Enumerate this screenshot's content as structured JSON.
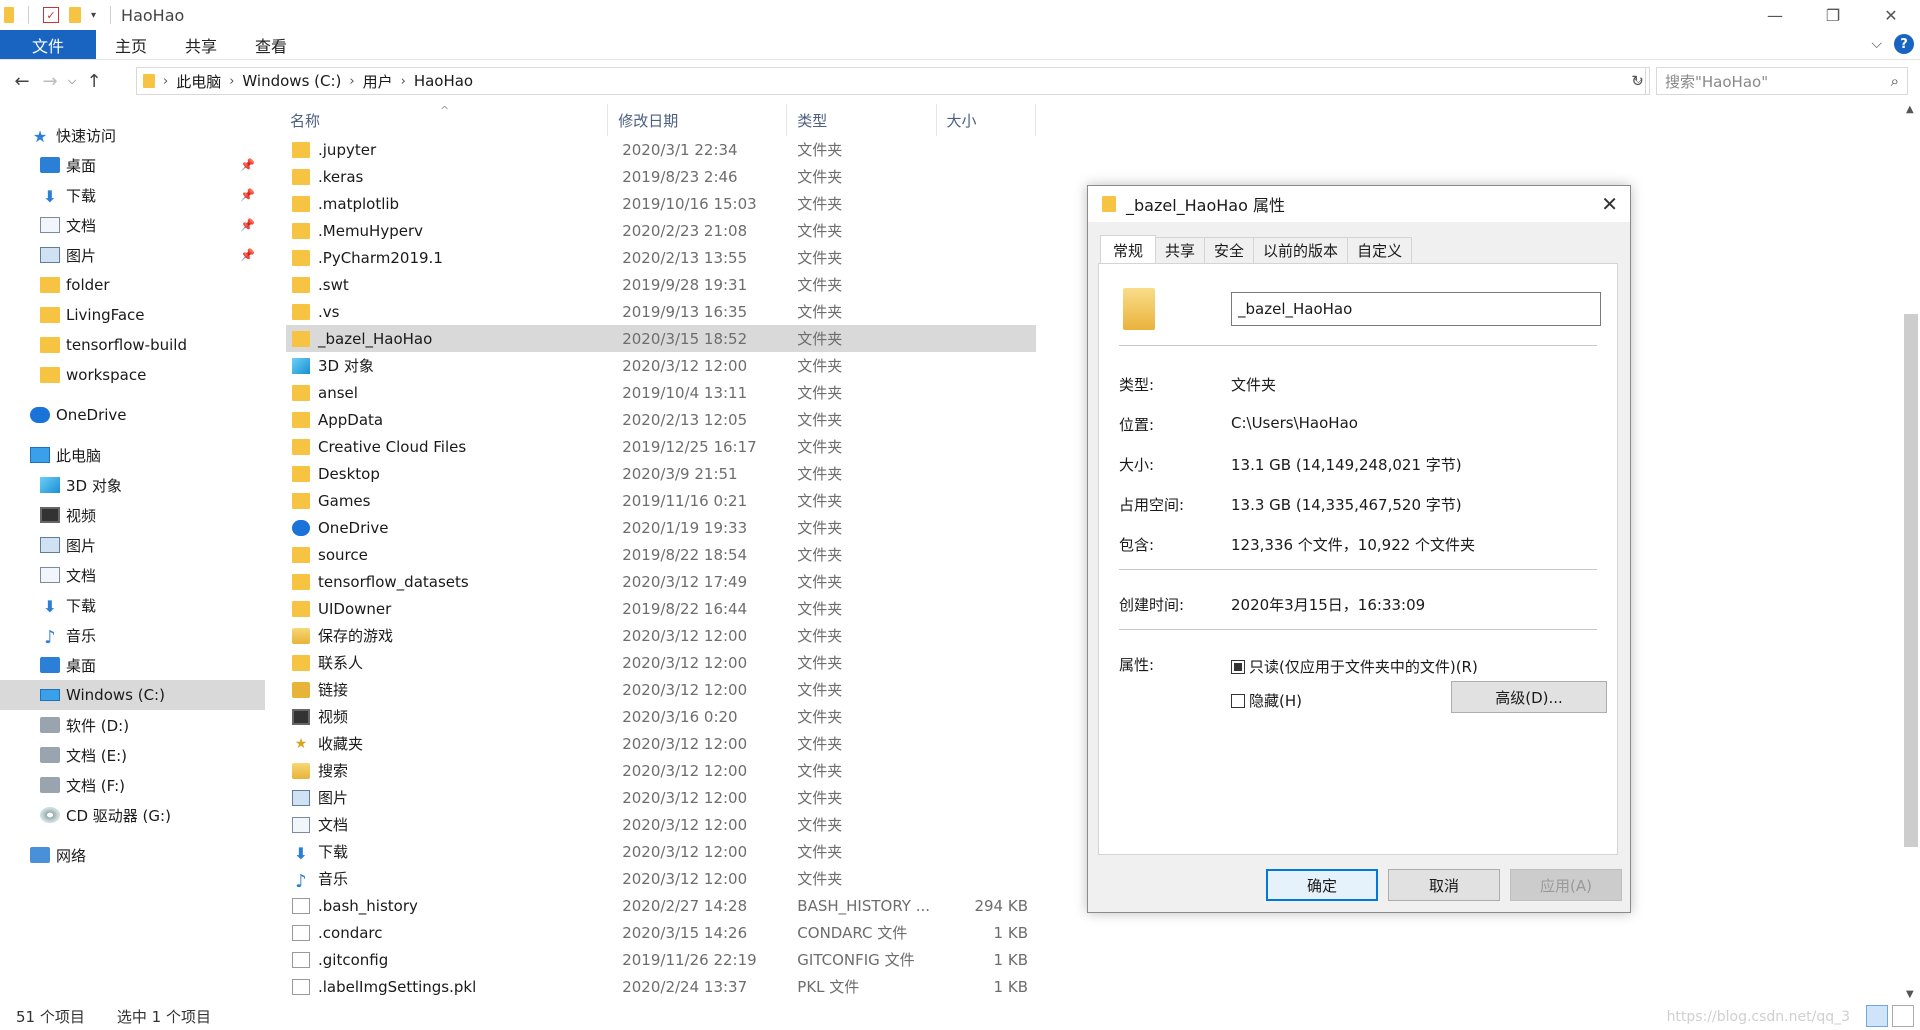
{
  "window": {
    "title": "HaoHao"
  },
  "ribbon": {
    "tabs": [
      "文件",
      "主页",
      "共享",
      "查看"
    ]
  },
  "address": {
    "crumbs": [
      "此电脑",
      "Windows (C:)",
      "用户",
      "HaoHao"
    ]
  },
  "search": {
    "placeholder": "搜索\"HaoHao\""
  },
  "sidebar": {
    "quick_access": "快速访问",
    "quick_items": [
      "桌面",
      "下载",
      "文档",
      "图片",
      "folder",
      "LivingFace",
      "tensorflow-build",
      "workspace"
    ],
    "onedrive": "OneDrive",
    "this_pc": "此电脑",
    "pc_items": [
      "3D 对象",
      "视频",
      "图片",
      "文档",
      "下载",
      "音乐",
      "桌面",
      "Windows (C:)",
      "软件 (D:)",
      "文档 (E:)",
      "文档 (F:)",
      "CD 驱动器 (G:)"
    ],
    "network": "网络"
  },
  "filelist": {
    "headers": {
      "name": "名称",
      "date": "修改日期",
      "type": "类型",
      "size": "大小"
    },
    "rows": [
      {
        "name": ".jupyter",
        "date": "2020/3/1 22:34",
        "type": "文件夹",
        "size": "",
        "icon": "folder"
      },
      {
        "name": ".keras",
        "date": "2019/8/23 2:46",
        "type": "文件夹",
        "size": "",
        "icon": "folder"
      },
      {
        "name": ".matplotlib",
        "date": "2019/10/16 15:03",
        "type": "文件夹",
        "size": "",
        "icon": "folder"
      },
      {
        "name": ".MemuHyperv",
        "date": "2020/2/23 21:08",
        "type": "文件夹",
        "size": "",
        "icon": "folder"
      },
      {
        "name": ".PyCharm2019.1",
        "date": "2020/2/13 13:55",
        "type": "文件夹",
        "size": "",
        "icon": "folder"
      },
      {
        "name": ".swt",
        "date": "2019/9/28 19:31",
        "type": "文件夹",
        "size": "",
        "icon": "folder"
      },
      {
        "name": ".vs",
        "date": "2019/9/13 16:35",
        "type": "文件夹",
        "size": "",
        "icon": "folder"
      },
      {
        "name": "_bazel_HaoHao",
        "date": "2020/3/15 18:52",
        "type": "文件夹",
        "size": "",
        "icon": "folder"
      },
      {
        "name": "3D 对象",
        "date": "2020/3/12 12:00",
        "type": "文件夹",
        "size": "",
        "icon": "cube"
      },
      {
        "name": "ansel",
        "date": "2019/10/4 13:11",
        "type": "文件夹",
        "size": "",
        "icon": "folder"
      },
      {
        "name": "AppData",
        "date": "2020/2/13 12:05",
        "type": "文件夹",
        "size": "",
        "icon": "folder"
      },
      {
        "name": "Creative Cloud Files",
        "date": "2019/12/25 16:17",
        "type": "文件夹",
        "size": "",
        "icon": "folder"
      },
      {
        "name": "Desktop",
        "date": "2020/3/9 21:51",
        "type": "文件夹",
        "size": "",
        "icon": "folder"
      },
      {
        "name": "Games",
        "date": "2019/11/16 0:21",
        "type": "文件夹",
        "size": "",
        "icon": "folder"
      },
      {
        "name": "OneDrive",
        "date": "2020/1/19 19:33",
        "type": "文件夹",
        "size": "",
        "icon": "cloud"
      },
      {
        "name": "source",
        "date": "2019/8/22 18:54",
        "type": "文件夹",
        "size": "",
        "icon": "folder"
      },
      {
        "name": "tensorflow_datasets",
        "date": "2020/3/12 17:49",
        "type": "文件夹",
        "size": "",
        "icon": "folder"
      },
      {
        "name": "UIDowner",
        "date": "2019/8/22 16:44",
        "type": "文件夹",
        "size": "",
        "icon": "folder"
      },
      {
        "name": "保存的游戏",
        "date": "2020/3/12 12:00",
        "type": "文件夹",
        "size": "",
        "icon": "games"
      },
      {
        "name": "联系人",
        "date": "2020/3/12 12:00",
        "type": "文件夹",
        "size": "",
        "icon": "folder"
      },
      {
        "name": "链接",
        "date": "2020/3/12 12:00",
        "type": "文件夹",
        "size": "",
        "icon": "link"
      },
      {
        "name": "视频",
        "date": "2020/3/16 0:20",
        "type": "文件夹",
        "size": "",
        "icon": "video"
      },
      {
        "name": "收藏夹",
        "date": "2020/3/12 12:00",
        "type": "文件夹",
        "size": "",
        "icon": "star"
      },
      {
        "name": "搜索",
        "date": "2020/3/12 12:00",
        "type": "文件夹",
        "size": "",
        "icon": "search"
      },
      {
        "name": "图片",
        "date": "2020/3/12 12:00",
        "type": "文件夹",
        "size": "",
        "icon": "picture"
      },
      {
        "name": "文档",
        "date": "2020/3/12 12:00",
        "type": "文件夹",
        "size": "",
        "icon": "document"
      },
      {
        "name": "下载",
        "date": "2020/3/12 12:00",
        "type": "文件夹",
        "size": "",
        "icon": "download"
      },
      {
        "name": "音乐",
        "date": "2020/3/12 12:00",
        "type": "文件夹",
        "size": "",
        "icon": "music"
      },
      {
        "name": ".bash_history",
        "date": "2020/2/27 14:28",
        "type": "BASH_HISTORY ...",
        "size": "294 KB",
        "icon": "file"
      },
      {
        "name": ".condarc",
        "date": "2020/3/15 14:26",
        "type": "CONDARC 文件",
        "size": "1 KB",
        "icon": "file"
      },
      {
        "name": ".gitconfig",
        "date": "2019/11/26 22:19",
        "type": "GITCONFIG 文件",
        "size": "1 KB",
        "icon": "file"
      },
      {
        "name": ".labelImgSettings.pkl",
        "date": "2020/2/24 13:37",
        "type": "PKL 文件",
        "size": "1 KB",
        "icon": "file"
      }
    ],
    "selected_index": 7
  },
  "status": {
    "count": "51 个项目",
    "selected": "选中 1 个项目",
    "watermark": "https://blog.csdn.net/qq_3"
  },
  "dialog": {
    "title": "_bazel_HaoHao 属性",
    "tabs": [
      "常规",
      "共享",
      "安全",
      "以前的版本",
      "自定义"
    ],
    "name_value": "_bazel_HaoHao",
    "type_label": "类型:",
    "type_value": "文件夹",
    "location_label": "位置:",
    "location_value": "C:\\Users\\HaoHao",
    "size_label": "大小:",
    "size_value": "13.1 GB (14,149,248,021 字节)",
    "disk_label": "占用空间:",
    "disk_value": "13.3 GB (14,335,467,520 字节)",
    "contains_label": "包含:",
    "contains_value": "123,336 个文件，10,922 个文件夹",
    "created_label": "创建时间:",
    "created_value": "2020年3月15日，16:33:09",
    "attr_label": "属性:",
    "readonly_label": "只读(仅应用于文件夹中的文件)(R)",
    "hidden_label": "隐藏(H)",
    "advanced_label": "高级(D)...",
    "ok_label": "确定",
    "cancel_label": "取消",
    "apply_label": "应用(A)"
  },
  "colors": {
    "accent": "#1a64c1",
    "selection": "#d9d9d9",
    "folder": "#f6c343"
  }
}
